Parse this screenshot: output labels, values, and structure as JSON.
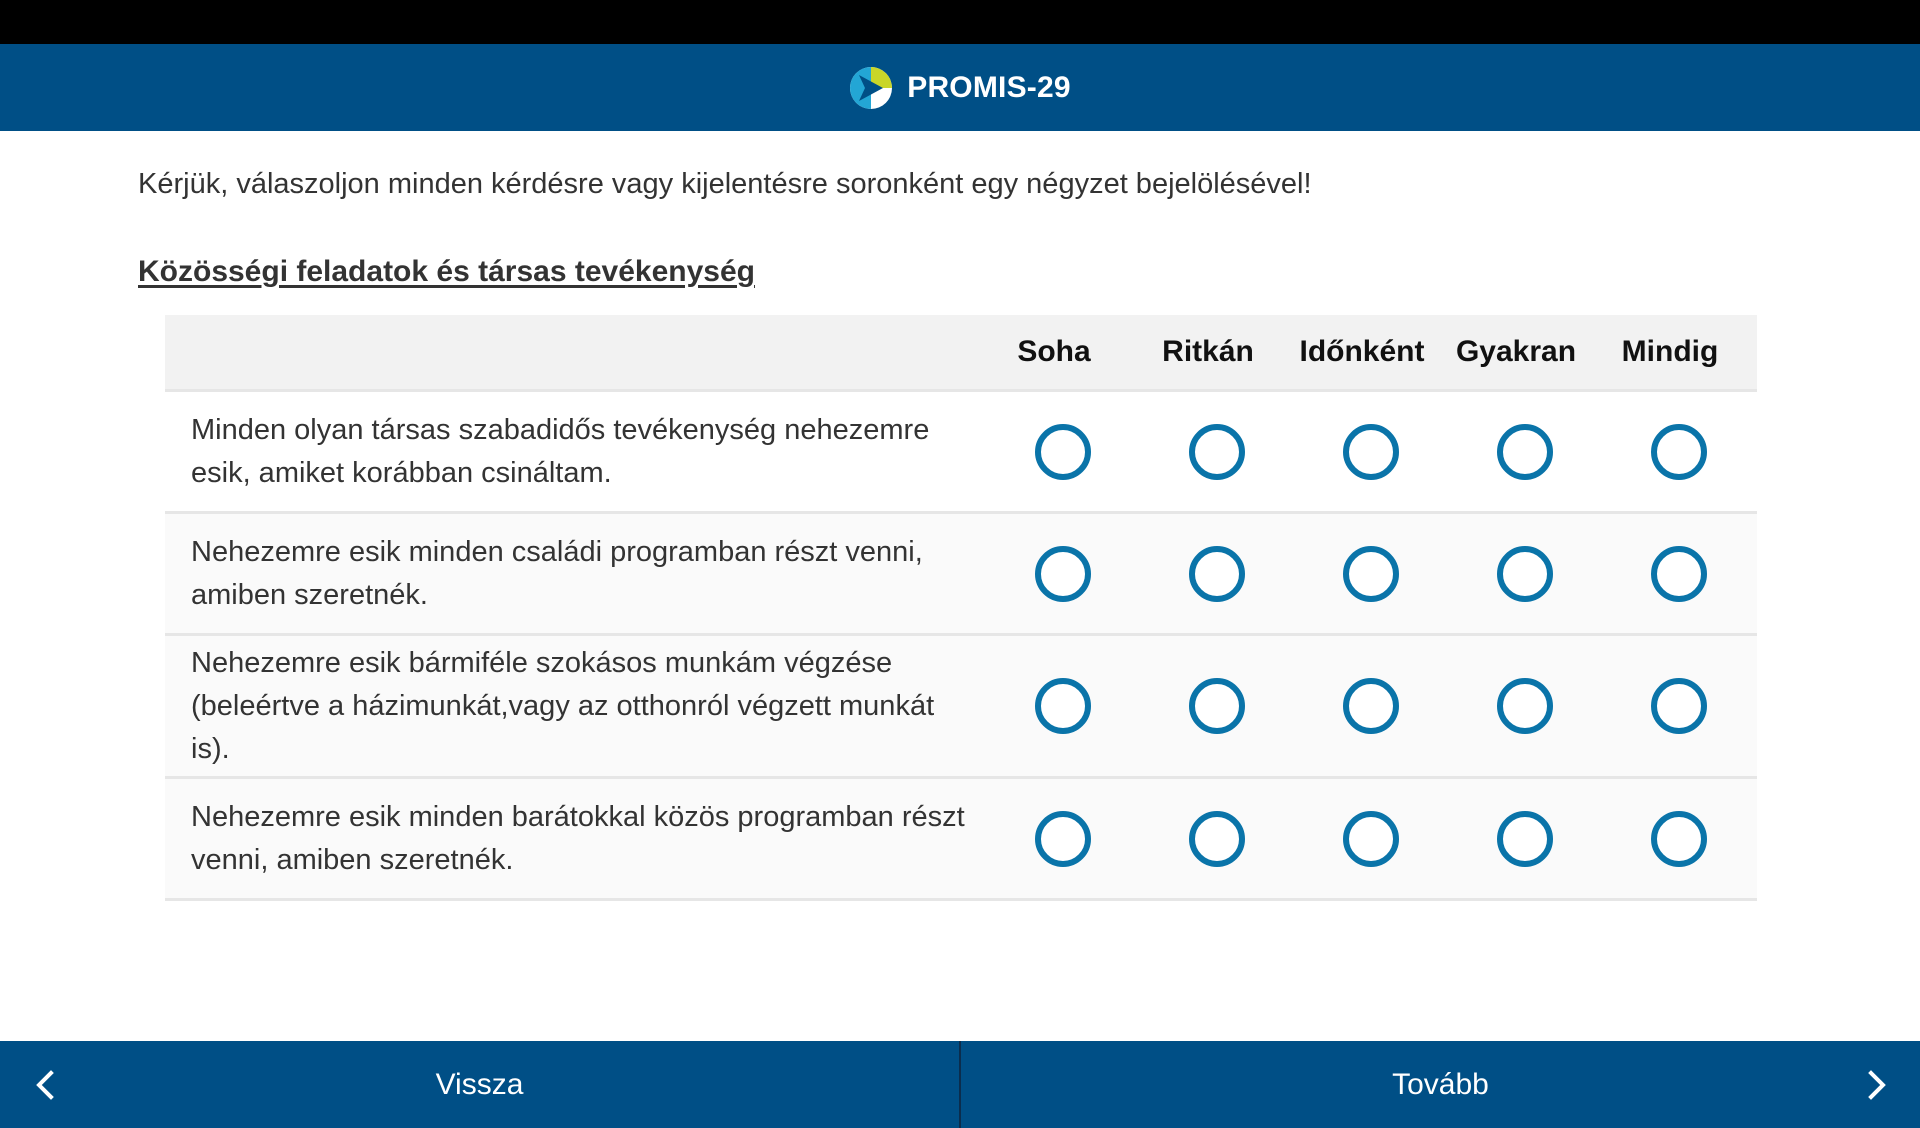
{
  "app": {
    "title": "PROMIS-29",
    "logo_colors": {
      "green": "#c9d629",
      "cyan": "#23a6d5",
      "navy": "#004f86"
    }
  },
  "instructions": "Kérjük, válaszoljon minden kérdésre vagy kijelentésre soronként egy négyzet bejelölésével!",
  "section": {
    "title": "Közösségi feladatok és társas tevékenység"
  },
  "columns": [
    "Soha",
    "Ritkán",
    "Időnként",
    "Gyakran",
    "Mindig"
  ],
  "rows": [
    {
      "question": "Minden olyan társas szabadidős tevékenység nehezemre esik, amiket korábban csináltam.",
      "selected": null
    },
    {
      "question": "Nehezemre esik minden családi programban részt venni, amiben szeretnék.",
      "selected": null
    },
    {
      "question": "Nehezemre esik bármiféle szokásos munkám végzése (beleértve a házimunkát,vagy az otthonról végzett munkát is).",
      "selected": null
    },
    {
      "question": "Nehezemre esik minden barátokkal közös programban részt venni, amiben szeretnék.",
      "selected": null
    }
  ],
  "footer": {
    "back_label": "Vissza",
    "next_label": "Tovább"
  },
  "colors": {
    "header": "#004f86",
    "radio": "#0a74a9",
    "header_row": "#f2f2f2"
  }
}
